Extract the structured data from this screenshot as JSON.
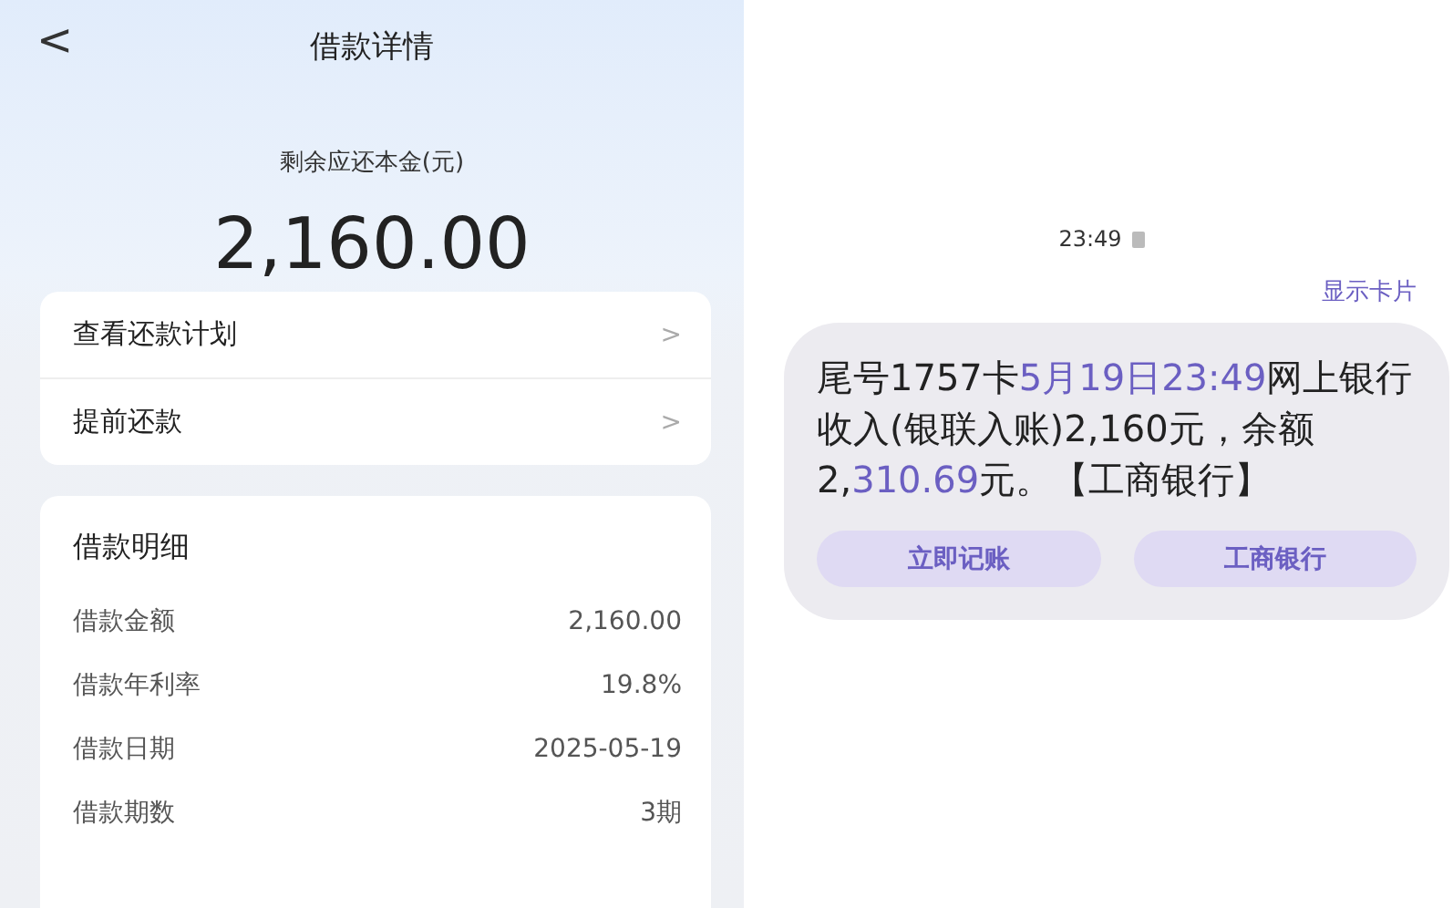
{
  "loan_screen": {
    "title": "借款详情",
    "back": "<",
    "remaining_label": "剩余应还本金(元)",
    "remaining_amount": "2,160.00",
    "actions": [
      {
        "label": "查看还款计划",
        "chevron": ">"
      },
      {
        "label": "提前还款",
        "chevron": ">"
      }
    ],
    "details": {
      "title": "借款明细",
      "rows": [
        {
          "label": "借款金额",
          "value": "2,160.00"
        },
        {
          "label": "借款年利率",
          "value": "19.8%"
        },
        {
          "label": "借款日期",
          "value": "2025-05-19"
        },
        {
          "label": "借款期数",
          "value": "3期"
        }
      ]
    }
  },
  "sms_screen": {
    "time": "23:49",
    "show_card": "显示卡片",
    "message_lines": [
      [
        {
          "text": "尾号1757卡",
          "link": false
        },
        {
          "text": "5月19日23:49",
          "link": true
        },
        {
          "text": "网上银行",
          "link": false
        }
      ],
      [
        {
          "text": "收入(银联入账)2,160元，余额",
          "link": false
        }
      ],
      [
        {
          "text": "2,",
          "link": false
        },
        {
          "text": "310.69",
          "link": true
        },
        {
          "text": "元。【工商银行】",
          "link": false
        }
      ]
    ],
    "buttons": [
      "立即记账",
      "工商银行"
    ]
  }
}
